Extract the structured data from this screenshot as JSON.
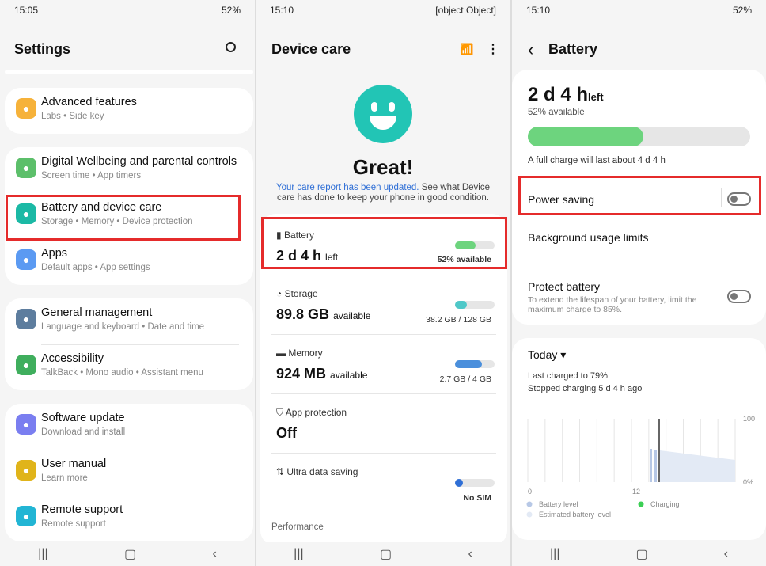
{
  "settings": {
    "status_time": "15:05",
    "battery": "52%",
    "title": "Settings",
    "items": [
      {
        "label": "Advanced features",
        "sub": "Labs • Side key",
        "color": "#f6b23a",
        "icon": "gear-plus-icon"
      },
      {
        "label": "Digital Wellbeing and parental controls",
        "sub": "Screen time • App timers",
        "color": "#5cbf6a",
        "icon": "wellbeing-icon"
      },
      {
        "label": "Battery and device care",
        "sub": "Storage • Memory • Device protection",
        "color": "#1bb9a5",
        "icon": "device-care-icon"
      },
      {
        "label": "Apps",
        "sub": "Default apps • App settings",
        "color": "#5b9af2",
        "icon": "apps-icon"
      },
      {
        "label": "General management",
        "sub": "Language and keyboard • Date and time",
        "color": "#5d7d9e",
        "icon": "sliders-icon"
      },
      {
        "label": "Accessibility",
        "sub": "TalkBack • Mono audio • Assistant menu",
        "color": "#3fae5d",
        "icon": "accessibility-icon"
      },
      {
        "label": "Software update",
        "sub": "Download and install",
        "color": "#7a7ef0",
        "icon": "update-icon"
      },
      {
        "label": "User manual",
        "sub": "Learn more",
        "color": "#e0b41a",
        "icon": "manual-icon"
      },
      {
        "label": "Remote support",
        "sub": "Remote support",
        "color": "#22b5d4",
        "icon": "headset-icon"
      }
    ]
  },
  "device_care": {
    "status_time": "15:10",
    "battery": {
      "label": "Battery",
      "value": "2 d 4 h",
      "unit": "left",
      "right": "52% available",
      "level": 52,
      "color": "#6dd47e"
    },
    "title": "Device care",
    "status": "Great!",
    "report_link": "Your care report has been updated.",
    "report_text": " See what Device care has done to keep your phone in good condition.",
    "storage": {
      "label": "Storage",
      "value": "89.8 GB",
      "unit": "available",
      "right": "38.2 GB / 128 GB",
      "level": 30,
      "color": "#4fc8c8"
    },
    "memory": {
      "label": "Memory",
      "value": "924 MB",
      "unit": "available",
      "right": "2.7 GB / 4 GB",
      "level": 68,
      "color": "#4a8fdc"
    },
    "app_protection": {
      "label": "App protection",
      "value": "Off"
    },
    "ultra": {
      "label": "Ultra data saving",
      "right": "No SIM"
    },
    "performance": "Performance"
  },
  "battery": {
    "status_time": "15:10",
    "battery_status": "52%",
    "title": "Battery",
    "left_value": "2 d 4 h",
    "left_unit": "left",
    "available": "52% available",
    "level": 52,
    "full_charge": "A full charge will last about 4 d 4 h",
    "power_saving": "Power saving",
    "background": "Background usage limits",
    "protect": "Protect battery",
    "protect_sub": "To extend the lifespan of your battery, limit the maximum charge to 85%.",
    "period": "Today",
    "last_charged": "Last charged to 79%",
    "stopped": "Stopped charging 5 d 4 h ago",
    "chart": {
      "x_ticks": [
        "0",
        "12"
      ],
      "y_ticks": [
        "100",
        "0%"
      ],
      "legend": [
        "Battery level",
        "Charging",
        "Estimated battery level"
      ],
      "colors": {
        "battery": "#b7c8e6",
        "charging": "#3ccf55",
        "estimated": "#e3eaf5"
      }
    }
  }
}
